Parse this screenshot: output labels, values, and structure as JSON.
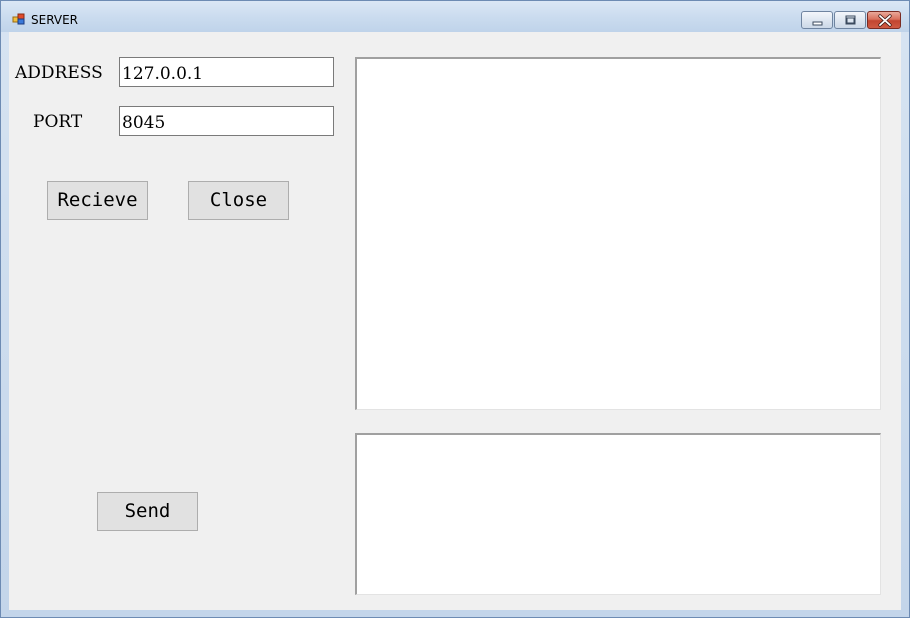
{
  "window": {
    "title": "SERVER",
    "icon": "app-window-icon",
    "caption_buttons": [
      "minimize",
      "restore",
      "close"
    ]
  },
  "form": {
    "address_label": "ADDRESS",
    "address_value": "127.0.0.1",
    "port_label": "PORT",
    "port_value": "8045",
    "receive_button": "Recieve",
    "close_button": "Close",
    "send_button": "Send"
  },
  "log_area": {
    "text": ""
  },
  "message_area": {
    "text": ""
  },
  "colors": {
    "client_background": "#f0f0f0",
    "button_face": "#e1e1e1",
    "close_caption": "#c24530"
  }
}
